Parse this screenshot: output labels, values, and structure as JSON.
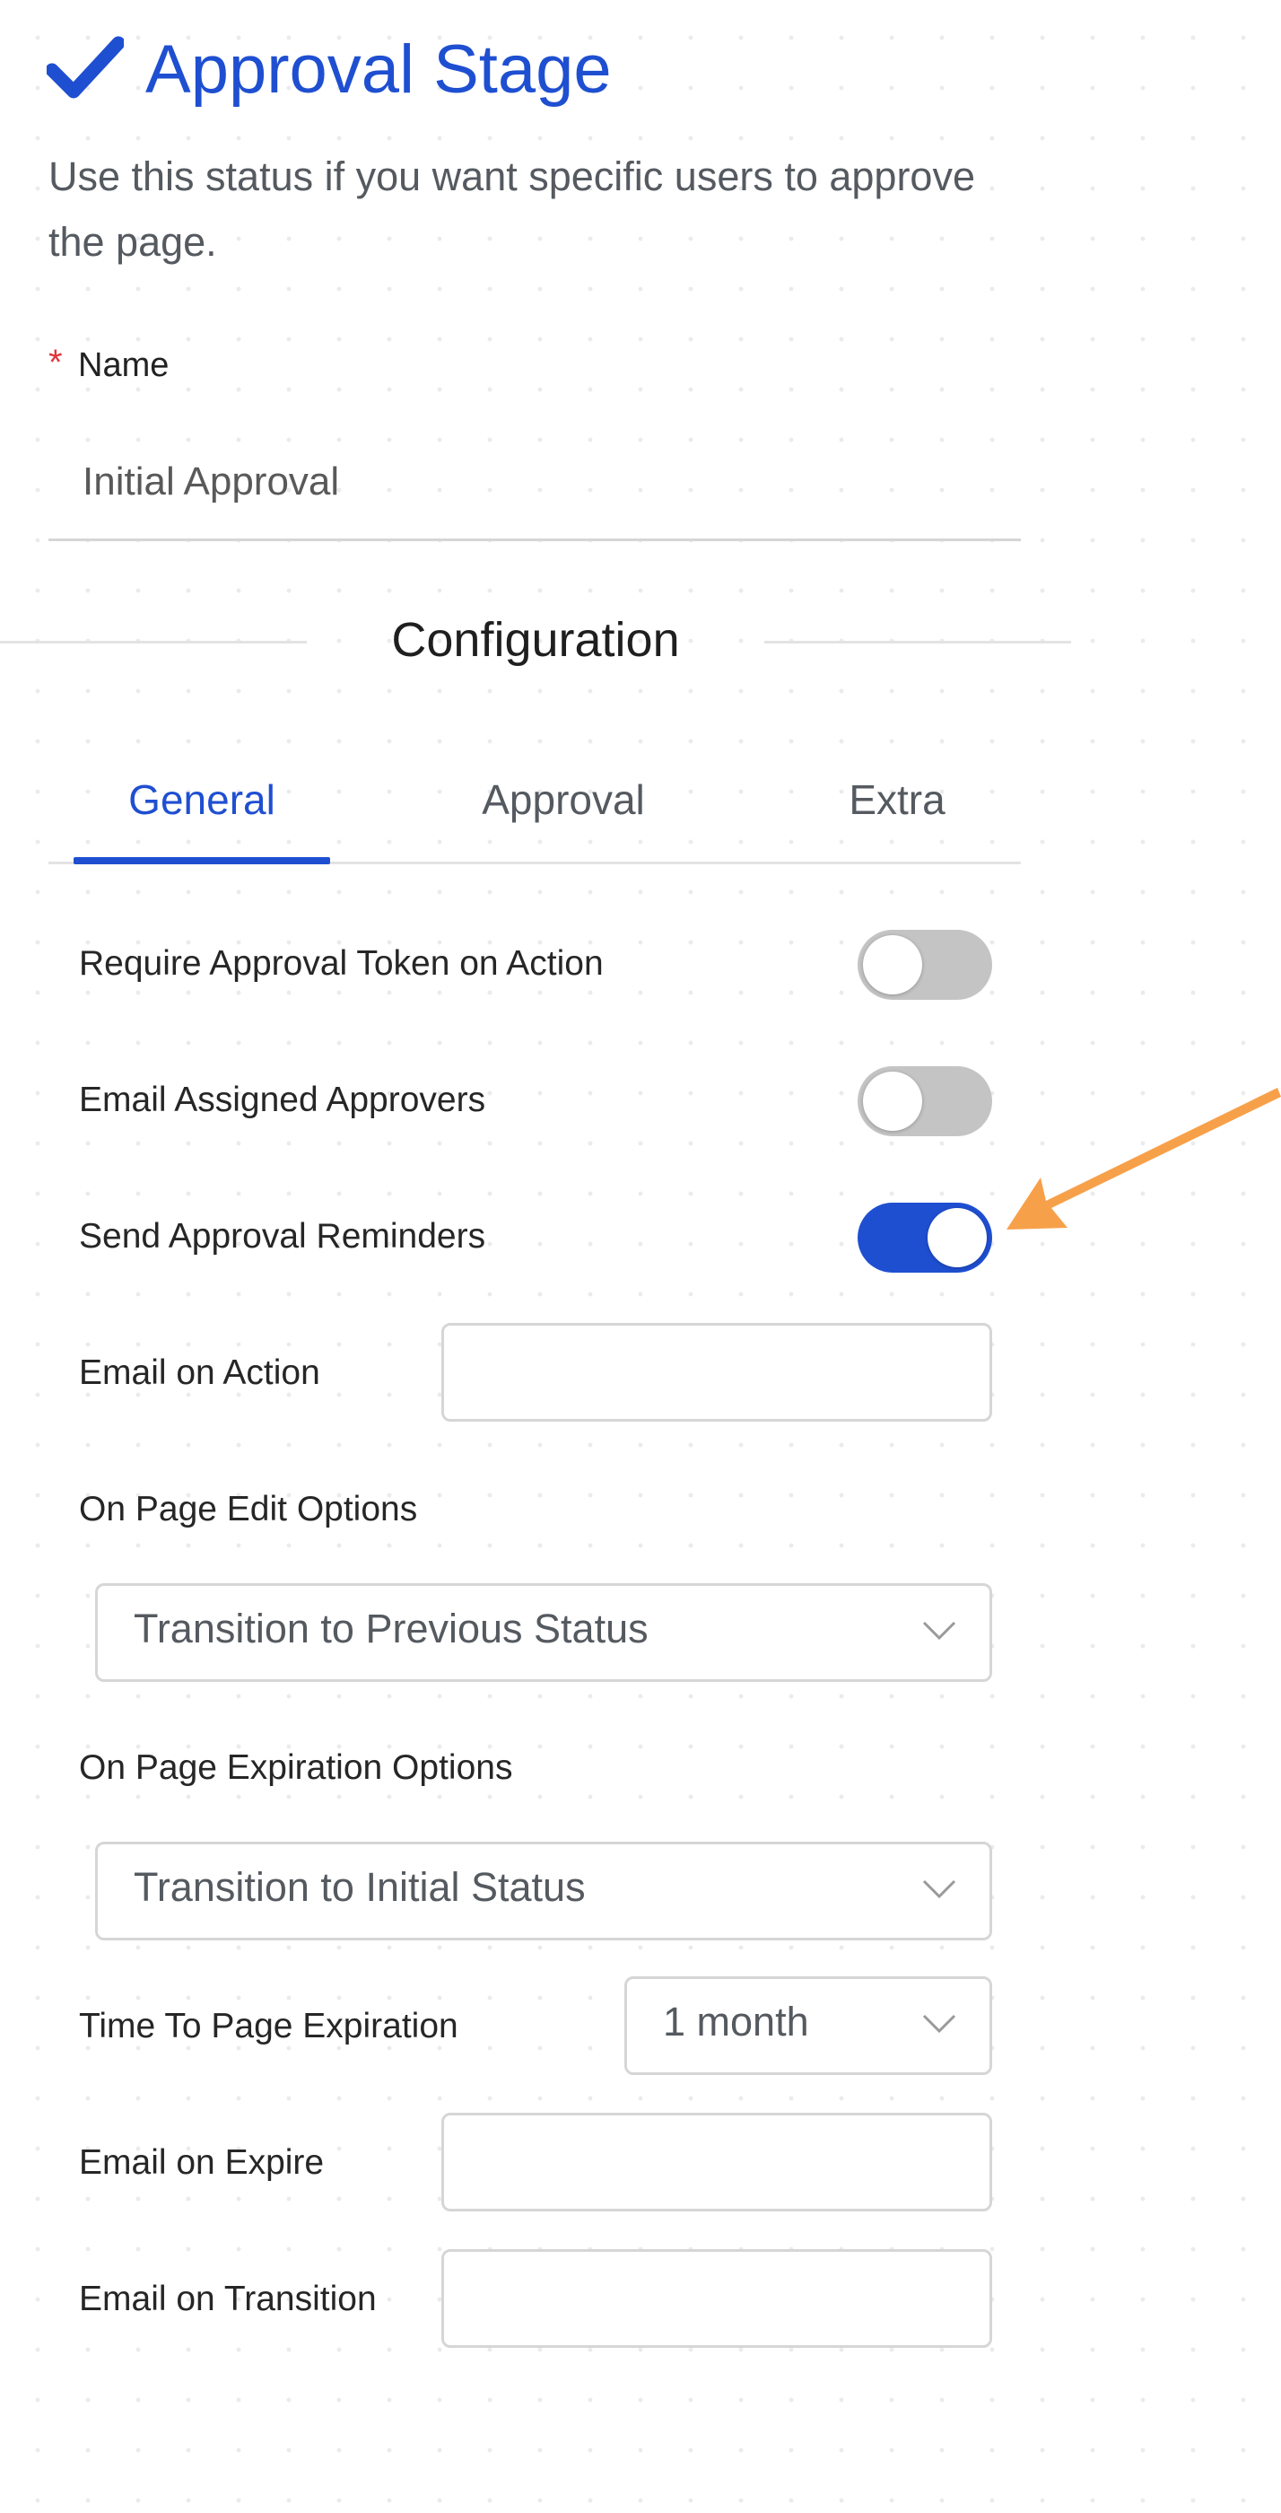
{
  "header": {
    "title": "Approval Stage",
    "description": "Use this status if you want specific users to approve the page."
  },
  "name_field": {
    "required_marker": "*",
    "label": "Name",
    "value": "Initial Approval"
  },
  "configuration": {
    "title": "Configuration",
    "tabs": [
      {
        "label": "General",
        "active": true
      },
      {
        "label": "Approval",
        "active": false
      },
      {
        "label": "Extra",
        "active": false
      }
    ]
  },
  "general": {
    "require_token": {
      "label": "Require Approval Token on Action",
      "enabled": false
    },
    "email_assigned": {
      "label": "Email Assigned Approvers",
      "enabled": false
    },
    "send_reminders": {
      "label": "Send Approval Reminders",
      "enabled": true
    },
    "email_on_action": {
      "label": "Email on Action",
      "value": ""
    },
    "on_page_edit": {
      "label": "On Page Edit Options",
      "selected": "Transition to Previous Status"
    },
    "on_page_expiration": {
      "label": "On Page Expiration Options",
      "selected": "Transition to Initial Status"
    },
    "time_to_expiration": {
      "label": "Time To Page Expiration",
      "selected": "1 month"
    },
    "email_on_expire": {
      "label": "Email on Expire",
      "value": ""
    },
    "email_on_transition": {
      "label": "Email on Transition",
      "value": ""
    }
  },
  "icons": {
    "title_icon": "checkmark-icon",
    "select_icon": "chevron-down-icon",
    "annotation": "annotation-arrow"
  },
  "colors": {
    "accent": "#1f4fd1",
    "toggle_off": "#c4c4c4",
    "required": "#e0343c",
    "annotation_arrow": "#f7a04a"
  }
}
